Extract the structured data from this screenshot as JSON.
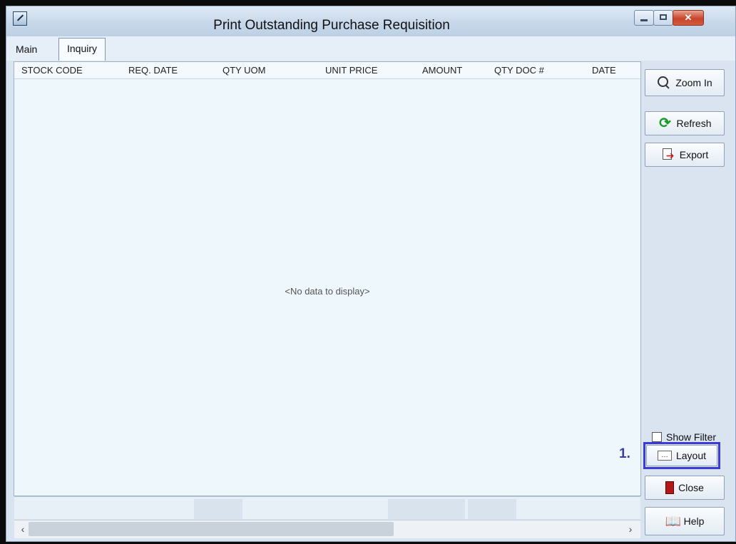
{
  "window": {
    "title": "Print Outstanding Purchase Requisition"
  },
  "tabs": [
    {
      "label": "Main"
    },
    {
      "label": "Inquiry"
    }
  ],
  "grid": {
    "columns": [
      "STOCK CODE",
      "REQ. DATE",
      "QTY UOM",
      "UNIT PRICE",
      "AMOUNT",
      "QTY DOC #",
      "DATE"
    ],
    "empty_message": "<No data to display>"
  },
  "side_panel": {
    "zoom_in": "Zoom In",
    "refresh": "Refresh",
    "export": "Export",
    "show_filter": "Show Filter",
    "layout": "Layout",
    "close": "Close",
    "help": "Help"
  },
  "annotation": {
    "step": "1."
  },
  "colors": {
    "highlight": "#3b3bd6",
    "grid_background": "#eef7fc"
  }
}
